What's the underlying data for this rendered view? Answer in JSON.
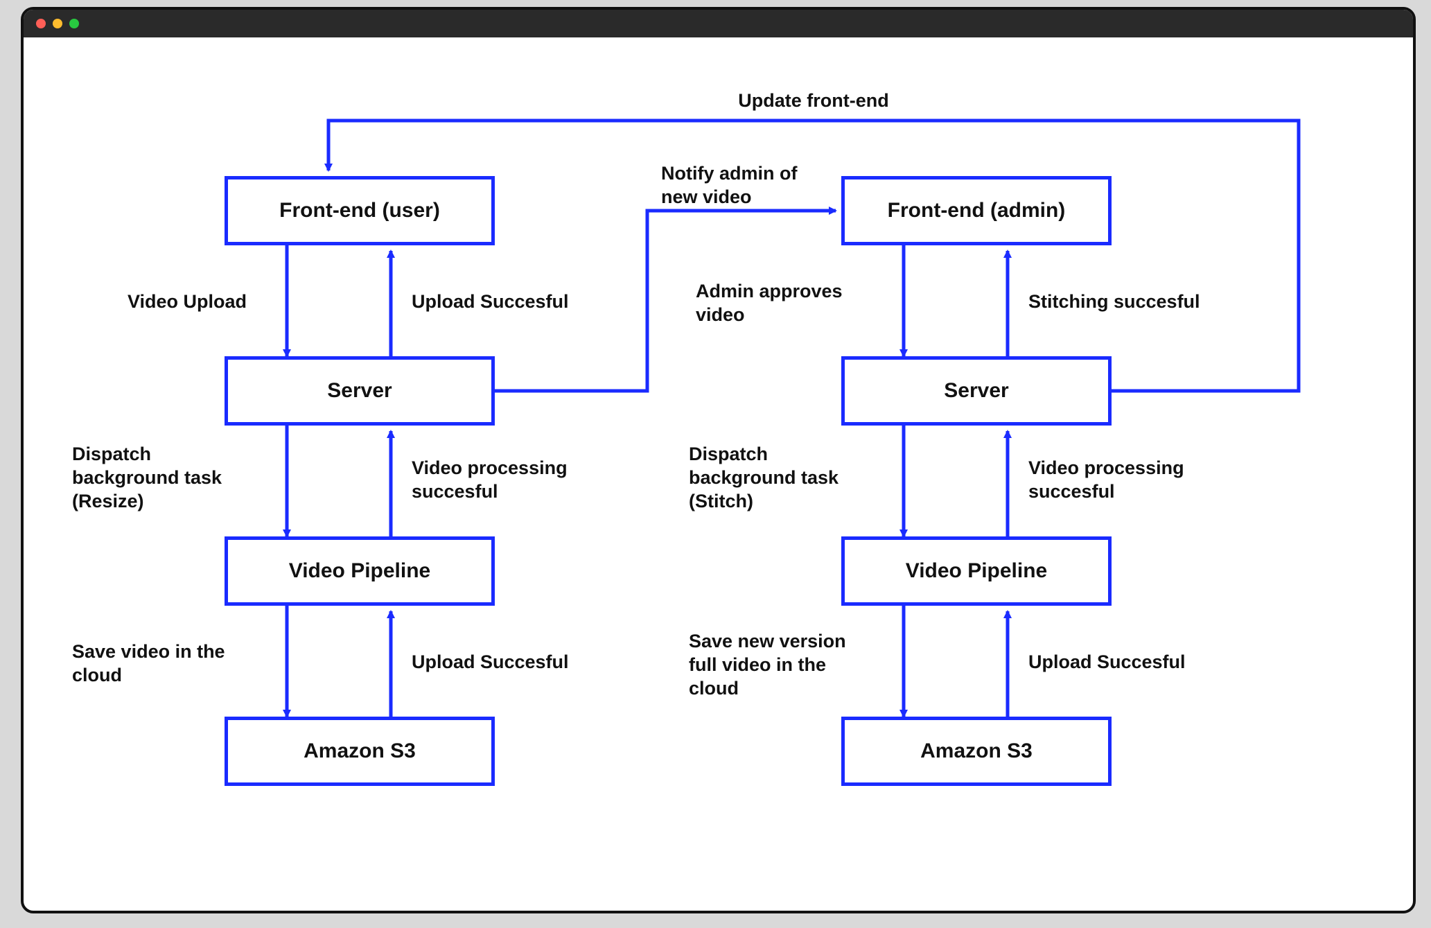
{
  "colors": {
    "arrow": "#1a2bff",
    "box_border": "#1a2bff",
    "text": "#111"
  },
  "left": {
    "nodes": {
      "frontend": "Front-end (user)",
      "server": "Server",
      "pipeline": "Video Pipeline",
      "s3": "Amazon S3"
    },
    "edges": {
      "upload": "Video Upload",
      "upload_ok": "Upload Succesful",
      "dispatch": "Dispatch\nbackground task\n(Resize)",
      "processing_ok": "Video processing\nsuccesful",
      "save_cloud": "Save video in the\ncloud",
      "s3_ok": "Upload Succesful"
    }
  },
  "right": {
    "nodes": {
      "frontend": "Front-end (admin)",
      "server": "Server",
      "pipeline": "Video Pipeline",
      "s3": "Amazon S3"
    },
    "edges": {
      "approve": "Admin approves\nvideo",
      "stitch_ok": "Stitching succesful",
      "dispatch": "Dispatch\nbackground task\n(Stitch)",
      "processing_ok": "Video processing\nsuccesful",
      "save_cloud": "Save new version\nfull video in the\ncloud",
      "s3_ok": "Upload Succesful"
    }
  },
  "cross": {
    "notify": "Notify admin of\nnew video",
    "update_frontend": "Update front-end"
  }
}
